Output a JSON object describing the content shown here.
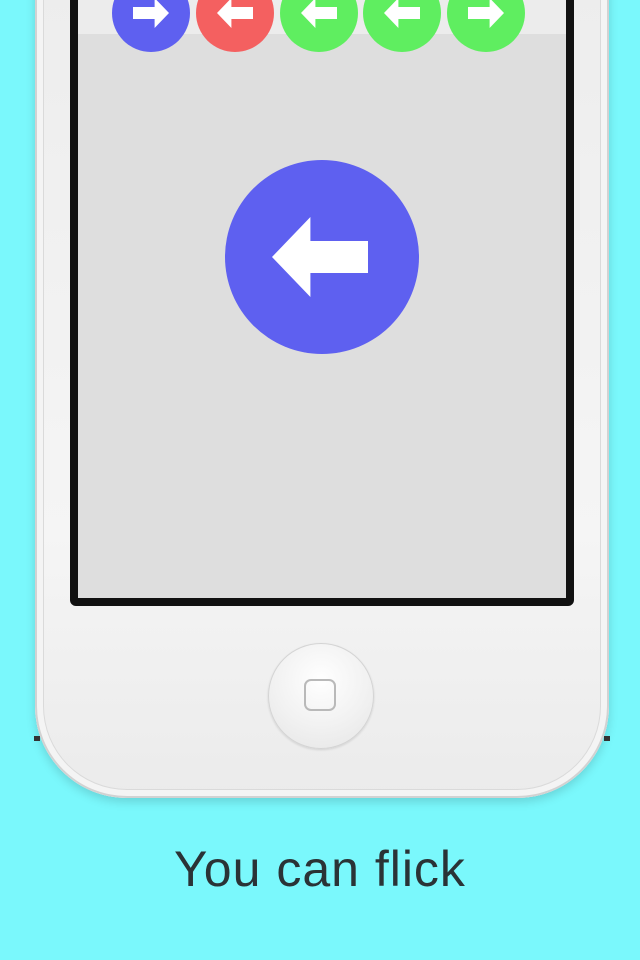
{
  "caption": "You can flick",
  "colors": {
    "background": "#7af8fc",
    "blue": "#5e60f0",
    "red": "#f46060",
    "green": "#5fee60",
    "screen": "#dedede"
  },
  "queue": [
    {
      "direction": "right",
      "color": "blue",
      "icon": "arrow-right-icon"
    },
    {
      "direction": "left",
      "color": "red",
      "icon": "arrow-left-icon"
    },
    {
      "direction": "left",
      "color": "green",
      "icon": "arrow-left-icon"
    },
    {
      "direction": "left",
      "color": "green",
      "icon": "arrow-left-icon"
    },
    {
      "direction": "right",
      "color": "green",
      "icon": "arrow-right-icon"
    }
  ],
  "current": {
    "direction": "left",
    "color": "blue",
    "icon": "arrow-left-icon"
  }
}
